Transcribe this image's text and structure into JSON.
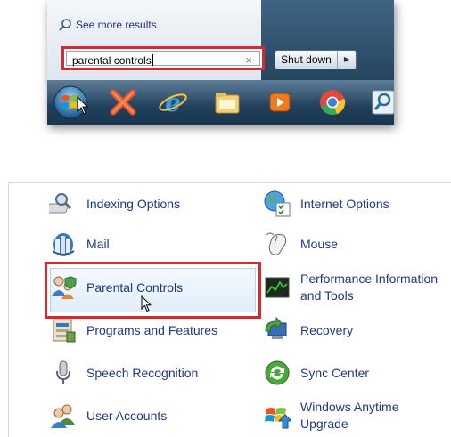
{
  "start_menu": {
    "see_more": "See more results",
    "search_value": "parental controls",
    "clear_symbol": "×",
    "shutdown_label": "Shut down",
    "shutdown_arrow": "▶",
    "taskbar_icons": [
      "windows-start-orb",
      "close-x-icon",
      "internet-explorer-icon",
      "windows-explorer-icon",
      "media-player-icon",
      "chrome-icon",
      "search-icon"
    ]
  },
  "control_panel": {
    "left_items": [
      {
        "label": "Indexing Options",
        "icon": "indexing-options-icon"
      },
      {
        "label": "Mail",
        "icon": "mail-icon"
      },
      {
        "label": "Parental Controls",
        "icon": "parental-controls-icon"
      },
      {
        "label": "Programs and Features",
        "icon": "programs-features-icon"
      },
      {
        "label": "Speech Recognition",
        "icon": "microphone-icon"
      },
      {
        "label": "User Accounts",
        "icon": "user-accounts-icon"
      }
    ],
    "right_items": [
      {
        "label": "Internet Options",
        "icon": "internet-options-icon"
      },
      {
        "label": "Mouse",
        "icon": "mouse-icon"
      },
      {
        "label": "Performance Information and Tools",
        "icon": "performance-icon"
      },
      {
        "label": "Recovery",
        "icon": "recovery-icon"
      },
      {
        "label": "Sync Center",
        "icon": "sync-center-icon"
      },
      {
        "label": "Windows Anytime Upgrade",
        "icon": "windows-anytime-upgrade-icon"
      }
    ]
  },
  "colors": {
    "highlight_border": "#d72a2f",
    "link_blue": "#1e3a87"
  }
}
